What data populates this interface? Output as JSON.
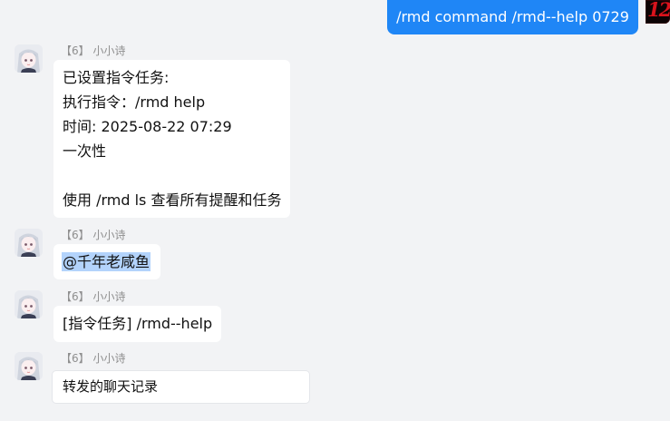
{
  "outgoing": {
    "text": "/rmd command /rmd--help 0729"
  },
  "self_avatar": {
    "label": "12"
  },
  "sender": {
    "level": "【6】",
    "name": "小小诗"
  },
  "messages": [
    {
      "lines": [
        "已设置指令任务:",
        "执行指令：/rmd help",
        "时间: 2025-08-22 07:29",
        "一次性",
        "",
        "使用 /rmd ls 查看所有提醒和任务"
      ]
    },
    {
      "mention": "@千年老咸鱼"
    },
    {
      "text": "[指令任务] /rmd--help"
    },
    {
      "forward_title": "转发的聊天记录"
    }
  ],
  "colors": {
    "outgoing_bubble": "#1f86f6",
    "background": "#f2f3f5",
    "incoming_bubble": "#ffffff",
    "mention_highlight": "#b3d3fb"
  }
}
